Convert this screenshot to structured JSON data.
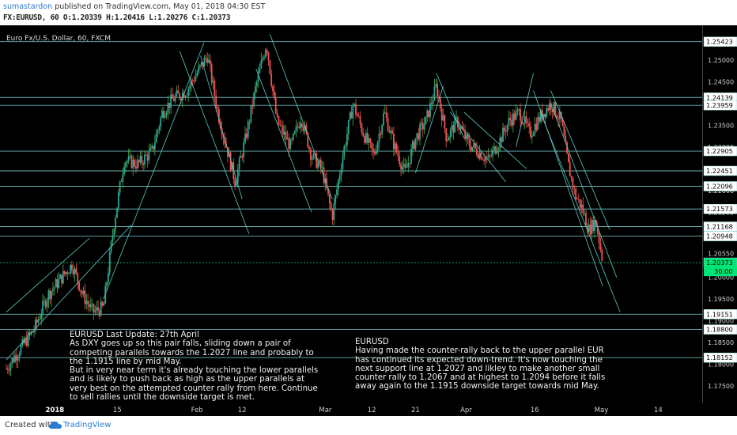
{
  "header": {
    "author": "sumastardon",
    "published": "published on TradingView.com, May 01, 2018 04:30 EST",
    "ohlc": "FX:EURUSD, 60  O:1.20339  H:1.20416  L:1.20276  C:1.20373"
  },
  "symbol_label": "Euro Fx/U.S. Dollar, 60, FXCM",
  "notes": {
    "left": [
      "EURUSD  Last Update: 27th April",
      "As DXY goes up so this pair falls, sliding down a pair of",
      "competing parallels towards the 1.2027 line and probably to",
      "the 1.1915 line by mid May.",
      "But in very near term it's already touching the lower parallels",
      "and is likely to push back as high as the upper parallels at",
      "very best on the attempted counter rally from here. Continue",
      "to sell rallies until the downside target is met."
    ],
    "right": [
      "EURUSD",
      "Having made the counter-rally back to the upper parallel EUR",
      "has continued its expected down-trend. It's now touching the",
      "next support line at 1.2027 and likley to make another small",
      "counter rally to 1.2067 and at highest to 1.2094 before it falls",
      "away again to the 1.1915 downside target towards mid May."
    ]
  },
  "footer": {
    "created": "Created with",
    "brand": "TradingView"
  },
  "colors": {
    "up": "#26a69a",
    "down": "#ef5350",
    "wick_up": "#4caf50",
    "hline": "#7fd3d3",
    "trend": "#5fc9c2",
    "current": "#00e676"
  },
  "chart_data": {
    "type": "candlestick",
    "y_range": [
      1.171,
      1.258
    ],
    "axis_ticks": [
      1.25,
      1.245,
      1.235,
      1.23,
      1.225,
      1.22,
      1.215,
      1.21,
      1.2055,
      1.2,
      1.195,
      1.19,
      1.185,
      1.18,
      1.175
    ],
    "axis_tick_labels": [
      "1.25000",
      "1.24500",
      "1.23500",
      "1.23000",
      "1.22500",
      "1.22000",
      "1.21500",
      "1.21000",
      "1.20550",
      "1.20000",
      "1.19500",
      "1.19000",
      "1.18500",
      "1.18000",
      "1.17500"
    ],
    "levels": [
      1.25423,
      1.24139,
      1.23959,
      1.22905,
      1.22451,
      1.22096,
      1.21573,
      1.21168,
      1.20948,
      1.20339,
      1.19151,
      1.188,
      1.18152
    ],
    "level_labels": [
      "1.25423",
      "1.24139",
      "1.23959",
      "1.22905",
      "1.22451",
      "1.22096",
      "1.21573",
      "1.21168",
      "1.20948",
      "1.20339",
      "1.19151",
      "1.18800",
      "1.18152"
    ],
    "current": {
      "price": 1.20373,
      "label": "1.20373",
      "countdown": "30:00"
    },
    "x_labels": [
      {
        "label": "2018",
        "t": 0.07
      },
      {
        "label": "15",
        "t": 0.16
      },
      {
        "label": "Feb",
        "t": 0.275
      },
      {
        "label": "12",
        "t": 0.34
      },
      {
        "label": "Mar",
        "t": 0.46
      },
      {
        "label": "12",
        "t": 0.527
      },
      {
        "label": "21",
        "t": 0.59
      },
      {
        "label": "Apr",
        "t": 0.663
      },
      {
        "label": "16",
        "t": 0.762
      },
      {
        "label": "May",
        "t": 0.858
      },
      {
        "label": "14",
        "t": 0.94
      }
    ],
    "path": [
      [
        0.0,
        1.179
      ],
      [
        0.04,
        1.188
      ],
      [
        0.06,
        1.196
      ],
      [
        0.08,
        1.2
      ],
      [
        0.095,
        1.203
      ],
      [
        0.11,
        1.196
      ],
      [
        0.125,
        1.192
      ],
      [
        0.14,
        1.193
      ],
      [
        0.155,
        1.212
      ],
      [
        0.17,
        1.227
      ],
      [
        0.19,
        1.226
      ],
      [
        0.21,
        1.229
      ],
      [
        0.225,
        1.238
      ],
      [
        0.24,
        1.241
      ],
      [
        0.26,
        1.243
      ],
      [
        0.275,
        1.247
      ],
      [
        0.29,
        1.251
      ],
      [
        0.305,
        1.238
      ],
      [
        0.33,
        1.222
      ],
      [
        0.345,
        1.232
      ],
      [
        0.36,
        1.244
      ],
      [
        0.375,
        1.254
      ],
      [
        0.39,
        1.236
      ],
      [
        0.41,
        1.23
      ],
      [
        0.425,
        1.237
      ],
      [
        0.44,
        1.228
      ],
      [
        0.455,
        1.225
      ],
      [
        0.47,
        1.214
      ],
      [
        0.485,
        1.228
      ],
      [
        0.5,
        1.24
      ],
      [
        0.515,
        1.233
      ],
      [
        0.53,
        1.228
      ],
      [
        0.545,
        1.238
      ],
      [
        0.56,
        1.23
      ],
      [
        0.575,
        1.224
      ],
      [
        0.59,
        1.232
      ],
      [
        0.605,
        1.236
      ],
      [
        0.62,
        1.244
      ],
      [
        0.635,
        1.232
      ],
      [
        0.65,
        1.236
      ],
      [
        0.665,
        1.231
      ],
      [
        0.68,
        1.229
      ],
      [
        0.695,
        1.227
      ],
      [
        0.71,
        1.231
      ],
      [
        0.725,
        1.236
      ],
      [
        0.74,
        1.238
      ],
      [
        0.755,
        1.233
      ],
      [
        0.77,
        1.237
      ],
      [
        0.785,
        1.24
      ],
      [
        0.8,
        1.236
      ],
      [
        0.81,
        1.226
      ],
      [
        0.82,
        1.219
      ],
      [
        0.83,
        1.216
      ],
      [
        0.84,
        1.211
      ],
      [
        0.85,
        1.213
      ],
      [
        0.86,
        1.2037
      ]
    ],
    "trendlines": [
      [
        0.0,
        1.181,
        0.18,
        1.212
      ],
      [
        0.0,
        1.192,
        0.12,
        1.209
      ],
      [
        0.14,
        1.195,
        0.285,
        1.254
      ],
      [
        0.25,
        1.252,
        0.35,
        1.21
      ],
      [
        0.28,
        1.251,
        0.34,
        1.218
      ],
      [
        0.36,
        1.248,
        0.44,
        1.215
      ],
      [
        0.38,
        1.256,
        0.47,
        1.218
      ],
      [
        0.59,
        1.224,
        0.63,
        1.244
      ],
      [
        0.62,
        1.247,
        0.66,
        1.232
      ],
      [
        0.64,
        1.238,
        0.72,
        1.222
      ],
      [
        0.66,
        1.238,
        0.75,
        1.225
      ],
      [
        0.735,
        1.23,
        0.76,
        1.247
      ],
      [
        0.76,
        1.243,
        0.86,
        1.198
      ],
      [
        0.785,
        1.243,
        0.87,
        1.211
      ],
      [
        0.77,
        1.238,
        0.885,
        1.192
      ],
      [
        0.785,
        1.24,
        0.88,
        1.2
      ]
    ]
  }
}
